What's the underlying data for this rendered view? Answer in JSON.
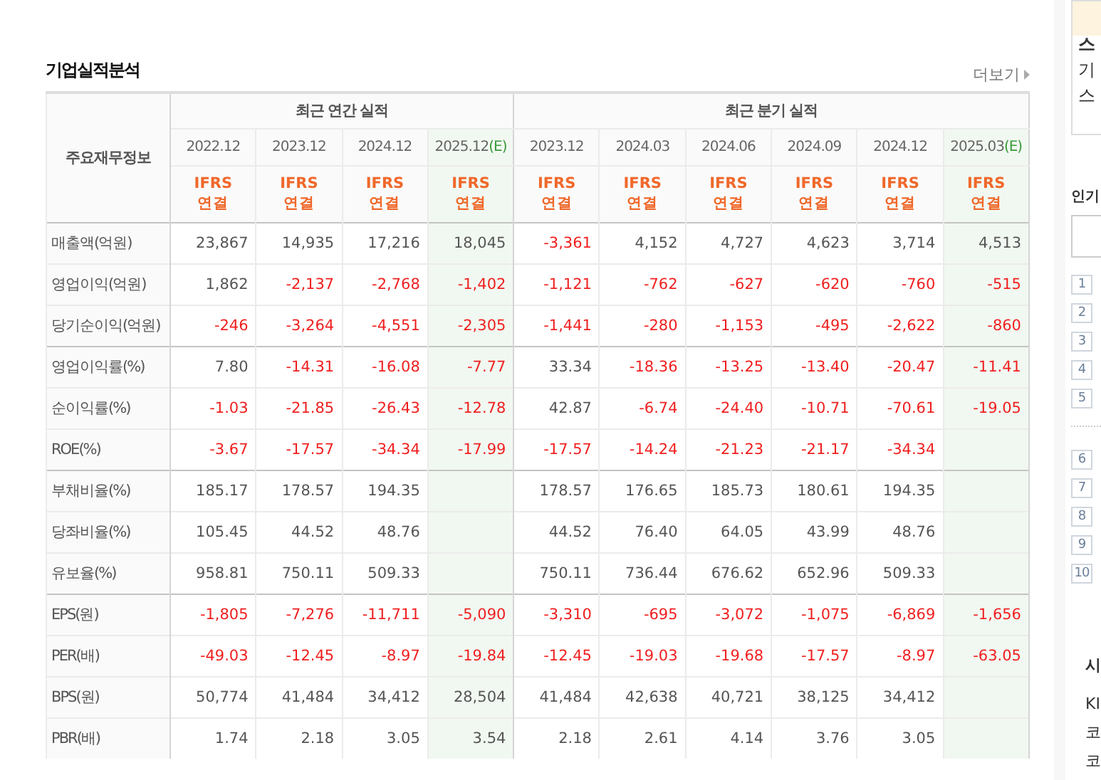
{
  "section": {
    "title": "기업실적분석",
    "more_link": "더보기"
  },
  "table": {
    "row_header": "주요재무정보",
    "groups": [
      {
        "label": "최근 연간 실적",
        "columns": [
          {
            "period": "2022.12",
            "estimate": false,
            "standard": "IFRS",
            "scope": "연결"
          },
          {
            "period": "2023.12",
            "estimate": false,
            "standard": "IFRS",
            "scope": "연결"
          },
          {
            "period": "2024.12",
            "estimate": false,
            "standard": "IFRS",
            "scope": "연결"
          },
          {
            "period": "2025.12",
            "estimate": true,
            "estimate_mark": "(E)",
            "standard": "IFRS",
            "scope": "연결"
          }
        ]
      },
      {
        "label": "최근 분기 실적",
        "columns": [
          {
            "period": "2023.12",
            "estimate": false,
            "standard": "IFRS",
            "scope": "연결"
          },
          {
            "period": "2024.03",
            "estimate": false,
            "standard": "IFRS",
            "scope": "연결"
          },
          {
            "period": "2024.06",
            "estimate": false,
            "standard": "IFRS",
            "scope": "연결"
          },
          {
            "period": "2024.09",
            "estimate": false,
            "standard": "IFRS",
            "scope": "연결"
          },
          {
            "period": "2024.12",
            "estimate": false,
            "standard": "IFRS",
            "scope": "연결"
          },
          {
            "period": "2025.03",
            "estimate": true,
            "estimate_mark": "(E)",
            "standard": "IFRS",
            "scope": "연결"
          }
        ]
      }
    ],
    "rows": [
      {
        "label": "매출액(억원)",
        "group_start": true,
        "annual": [
          "23,867",
          "14,935",
          "17,216",
          "18,045"
        ],
        "quarterly": [
          "-3,361",
          "4,152",
          "4,727",
          "4,623",
          "3,714",
          "4,513"
        ]
      },
      {
        "label": "영업이익(억원)",
        "group_start": false,
        "annual": [
          "1,862",
          "-2,137",
          "-2,768",
          "-1,402"
        ],
        "quarterly": [
          "-1,121",
          "-762",
          "-627",
          "-620",
          "-760",
          "-515"
        ]
      },
      {
        "label": "당기순이익(억원)",
        "group_start": false,
        "annual": [
          "-246",
          "-3,264",
          "-4,551",
          "-2,305"
        ],
        "quarterly": [
          "-1,441",
          "-280",
          "-1,153",
          "-495",
          "-2,622",
          "-860"
        ]
      },
      {
        "label": "영업이익률(%)",
        "group_start": true,
        "annual": [
          "7.80",
          "-14.31",
          "-16.08",
          "-7.77"
        ],
        "quarterly": [
          "33.34",
          "-18.36",
          "-13.25",
          "-13.40",
          "-20.47",
          "-11.41"
        ]
      },
      {
        "label": "순이익률(%)",
        "group_start": false,
        "annual": [
          "-1.03",
          "-21.85",
          "-26.43",
          "-12.78"
        ],
        "quarterly": [
          "42.87",
          "-6.74",
          "-24.40",
          "-10.71",
          "-70.61",
          "-19.05"
        ]
      },
      {
        "label": "ROE(%)",
        "group_start": false,
        "annual": [
          "-3.67",
          "-17.57",
          "-34.34",
          "-17.99"
        ],
        "quarterly": [
          "-17.57",
          "-14.24",
          "-21.23",
          "-21.17",
          "-34.34"
        ]
      },
      {
        "label": "부채비율(%)",
        "group_start": true,
        "annual": [
          "185.17",
          "178.57",
          "194.35"
        ],
        "quarterly": [
          "178.57",
          "176.65",
          "185.73",
          "180.61",
          "194.35"
        ]
      },
      {
        "label": "당좌비율(%)",
        "group_start": false,
        "annual": [
          "105.45",
          "44.52",
          "48.76"
        ],
        "quarterly": [
          "44.52",
          "76.40",
          "64.05",
          "43.99",
          "48.76"
        ]
      },
      {
        "label": "유보율(%)",
        "group_start": false,
        "annual": [
          "958.81",
          "750.11",
          "509.33"
        ],
        "quarterly": [
          "750.11",
          "736.44",
          "676.62",
          "652.96",
          "509.33"
        ]
      },
      {
        "label": "EPS(원)",
        "group_start": true,
        "annual": [
          "-1,805",
          "-7,276",
          "-11,711",
          "-5,090"
        ],
        "quarterly": [
          "-3,310",
          "-695",
          "-3,072",
          "-1,075",
          "-6,869",
          "-1,656"
        ]
      },
      {
        "label": "PER(배)",
        "group_start": false,
        "annual": [
          "-49.03",
          "-12.45",
          "-8.97",
          "-19.84"
        ],
        "quarterly": [
          "-12.45",
          "-19.03",
          "-19.68",
          "-17.57",
          "-8.97",
          "-63.05"
        ]
      },
      {
        "label": "BPS(원)",
        "group_start": false,
        "annual": [
          "50,774",
          "41,484",
          "34,412",
          "28,504"
        ],
        "quarterly": [
          "41,484",
          "42,638",
          "40,721",
          "38,125",
          "34,412"
        ]
      },
      {
        "label": "PBR(배)",
        "group_start": false,
        "annual": [
          "1.74",
          "2.18",
          "3.05",
          "3.54"
        ],
        "quarterly": [
          "2.18",
          "2.61",
          "4.14",
          "3.76",
          "3.05"
        ]
      }
    ]
  },
  "sidebar": {
    "box_lines": [
      "스",
      "기",
      "스"
    ],
    "heading": "인기",
    "ranks": [
      "1",
      "2",
      "3",
      "4",
      "5",
      "6",
      "7",
      "8",
      "9",
      "10"
    ],
    "section_title": "시",
    "lines": [
      "KI",
      "코",
      "코"
    ]
  }
}
